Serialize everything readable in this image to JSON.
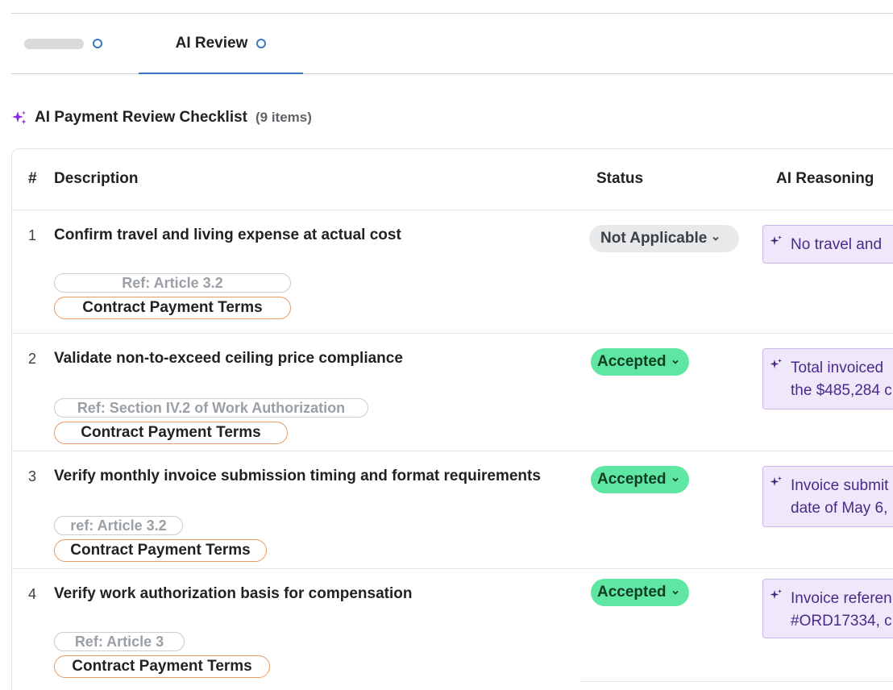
{
  "tabs": [
    {
      "label": "",
      "placeholder": true
    },
    {
      "label": "AI Review",
      "active": true
    }
  ],
  "section": {
    "title": "AI Payment Review Checklist",
    "count": "(9 items)"
  },
  "table": {
    "headers": {
      "num": "#",
      "description": "Description",
      "status": "Status",
      "reasoning": "AI Reasoning"
    },
    "rows": [
      {
        "num": "1",
        "description": "Confirm travel and living expense at actual cost",
        "ref": "Ref: Article 3.2",
        "source": "Contract Payment Terms",
        "status": "Not Applicable",
        "reasoning": [
          "No travel and",
          ""
        ]
      },
      {
        "num": "2",
        "description": "Validate non-to-exceed ceiling price compliance",
        "ref": "Ref: Section IV.2 of Work Authorization",
        "source": "Contract Payment Terms",
        "status": "Accepted",
        "reasoning": [
          "Total invoiced",
          "the $485,284 c"
        ]
      },
      {
        "num": "3",
        "description": "Verify monthly invoice submission timing and format requirements",
        "ref": "ref: Article 3.2",
        "source": "Contract Payment Terms",
        "status": "Accepted",
        "reasoning": [
          "Invoice submit",
          "date of May 6,"
        ]
      },
      {
        "num": "4",
        "description": "Verify work authorization basis for compensation",
        "ref": "Ref: Article 3",
        "source": "Contract Payment Terms",
        "status": "Accepted",
        "reasoning": [
          "Invoice referen",
          "#ORD17334, c"
        ]
      }
    ]
  },
  "colors": {
    "accent": "#3b78c2",
    "accepted_bg": "#5fe6a2",
    "not_applicable_bg": "#e8e9eb",
    "reasoning_bg": "#efe8fb",
    "reasoning_text": "#4a2a86",
    "source_border": "#e99a62",
    "sparkle": "#8a2be2"
  },
  "icons": {
    "tab_status": "circle-outline-icon",
    "section": "sparkle-icon",
    "status_dropdown": "chevron-down-icon",
    "reasoning": "sparkle-icon"
  }
}
